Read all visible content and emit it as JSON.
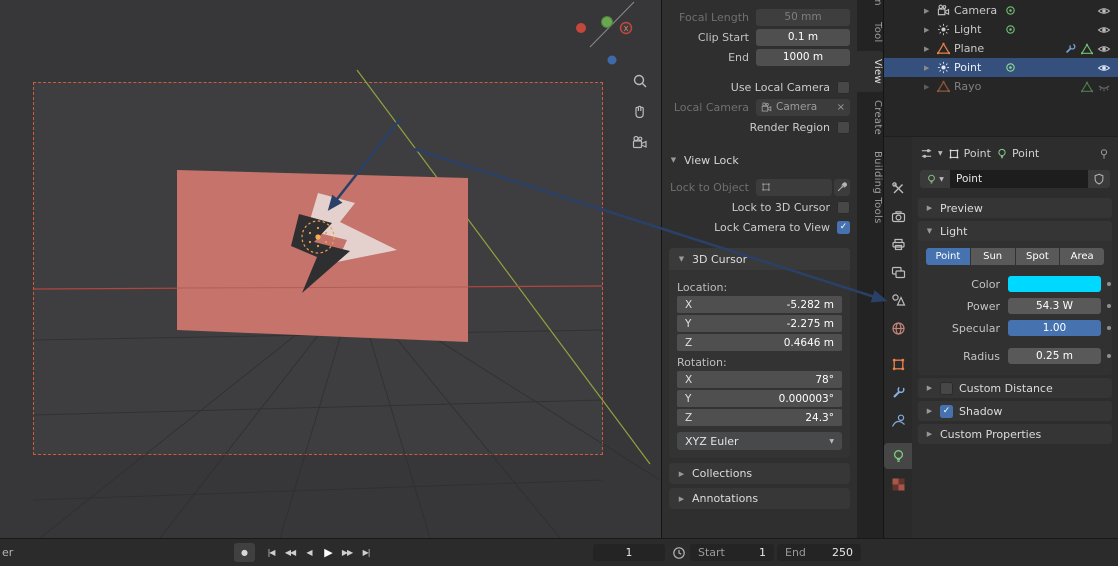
{
  "colors": {
    "accent_blue": "#4673b0",
    "selection_blue": "#35507d",
    "plane_salmon": "#c5736b",
    "camera_border_orange": "#cf5a3d",
    "annotation_navy": "#2b4066",
    "light_color_cyan": "#00d9ff"
  },
  "icons": {
    "collapse": "▼",
    "expand": "▶",
    "check": "✓",
    "close": "×",
    "record": "●",
    "jump_start": "|◀",
    "prev_key": "◀◀",
    "play_back": "◀",
    "play": "▶",
    "next_key": "▶▶",
    "jump_end": "▶|",
    "dropdown": "▼"
  },
  "nav_gizmo": {
    "x_label": "X"
  },
  "sidebar": {
    "tabs": [
      {
        "label": "Item",
        "active": false
      },
      {
        "label": "Tool",
        "active": false
      },
      {
        "label": "View",
        "active": true
      },
      {
        "label": "Create",
        "active": false
      },
      {
        "label": "Building Tools",
        "active": false
      }
    ],
    "camera_section": {
      "focal_length_label": "Focal Length",
      "focal_length_value": "50 mm",
      "clip_start_label": "Clip Start",
      "clip_start_value": "0.1 m",
      "end_label": "End",
      "end_value": "1000 m",
      "use_local_camera_label": "Use Local Camera",
      "local_camera_label": "Local Camera",
      "local_camera_value": "Camera",
      "render_region_label": "Render Region"
    },
    "view_lock": {
      "title": "View Lock",
      "lock_to_object_label": "Lock to Object",
      "lock_to_3d_cursor_label": "Lock to 3D Cursor",
      "lock_camera_to_view_label": "Lock Camera to View"
    },
    "cursor": {
      "title": "3D Cursor",
      "location_label": "Location:",
      "loc_x_axis": "X",
      "loc_x_value": "-5.282 m",
      "loc_y_axis": "Y",
      "loc_y_value": "-2.275 m",
      "loc_z_axis": "Z",
      "loc_z_value": "0.4646 m",
      "rotation_label": "Rotation:",
      "rot_x_axis": "X",
      "rot_x_value": "78°",
      "rot_y_axis": "Y",
      "rot_y_value": "0.000003°",
      "rot_z_axis": "Z",
      "rot_z_value": "24.3°",
      "rotation_mode": "XYZ Euler"
    },
    "collections_title": "Collections",
    "annotations_title": "Annotations"
  },
  "outliner": {
    "items": [
      {
        "label": "Camera",
        "icon": "camera"
      },
      {
        "label": "Light",
        "icon": "point-light"
      },
      {
        "label": "Plane",
        "icon": "mesh-triangle"
      },
      {
        "label": "Point",
        "icon": "point-light",
        "selected": true
      },
      {
        "label": "Rayo",
        "icon": "mesh-triangle",
        "hidden": true
      }
    ]
  },
  "properties": {
    "breadcrumb_object": "Point",
    "breadcrumb_data": "Point",
    "name_value": "Point",
    "preview_title": "Preview",
    "light_title": "Light",
    "light_types": [
      "Point",
      "Sun",
      "Spot",
      "Area"
    ],
    "active_light_type": "Point",
    "color_label": "Color",
    "color_value": "#00d9ff",
    "power_label": "Power",
    "power_value": "54.3 W",
    "specular_label": "Specular",
    "specular_value": "1.00",
    "radius_label": "Radius",
    "radius_value": "0.25 m",
    "custom_distance_title": "Custom Distance",
    "shadow_title": "Shadow",
    "custom_properties_title": "Custom Properties"
  },
  "timeline": {
    "left_text": "er",
    "current_frame": "1",
    "start_label": "Start",
    "start_value": "1",
    "end_label": "End",
    "end_value": "250"
  }
}
